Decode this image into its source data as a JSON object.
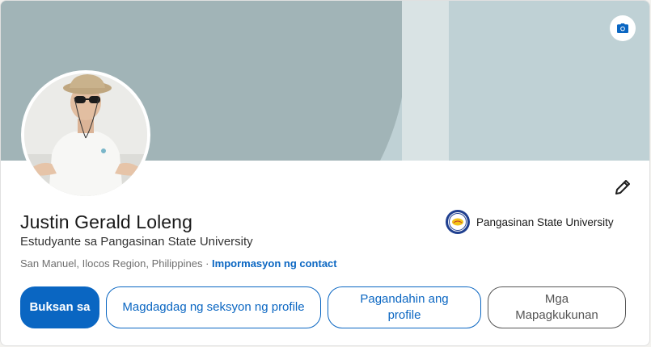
{
  "profile": {
    "name": "Justin Gerald Loleng",
    "headline": "Estudyante sa Pangasinan State University",
    "location": "San Manuel, Ilocos Region, Philippines",
    "separator": " · ",
    "contact_link": "Impormasyon ng contact"
  },
  "education": {
    "school": "Pangasinan State University"
  },
  "actions": {
    "open_to": "Buksan sa",
    "add_section": "Magdagdag ng seksyon ng profile",
    "enhance_profile": "Pagandahin ang profile",
    "resources": "Mga Mapagkukunan"
  },
  "icons": {
    "banner_edit": "camera-icon",
    "intro_edit": "pencil-icon"
  },
  "colors": {
    "primary": "#0a66c2",
    "banner": "#bfd1d5",
    "banner_arc": "#a1b4b7"
  }
}
